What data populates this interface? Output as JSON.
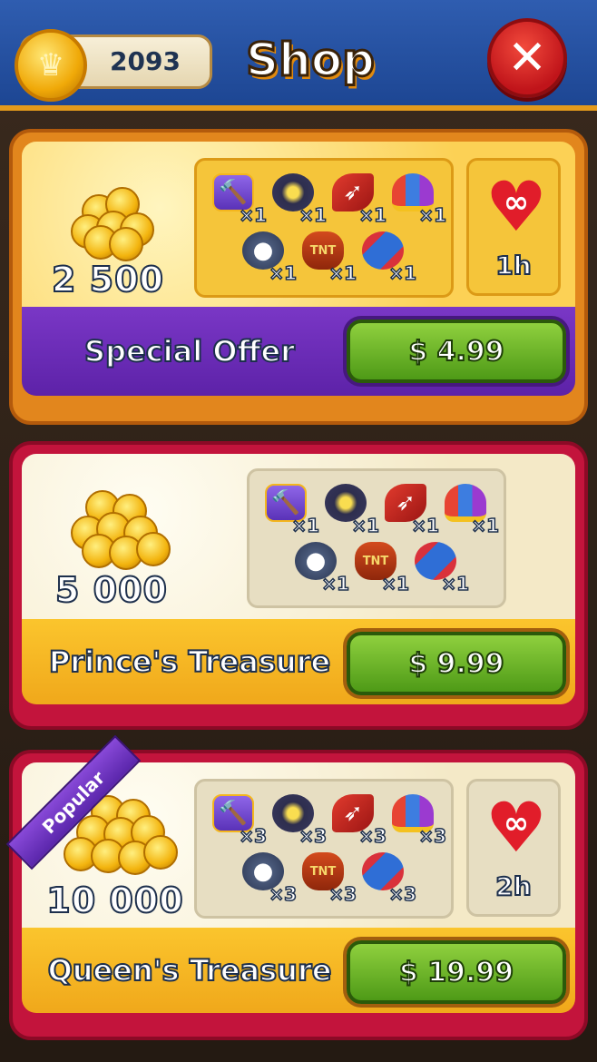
{
  "header": {
    "coin_count": "2093",
    "crown_glyph": "♛",
    "title": "Shop",
    "close_glyph": "✕"
  },
  "items_icons": [
    "hammer-booster",
    "cannon-booster",
    "arrow-booster",
    "jester-hat-booster",
    "color-bomb-booster",
    "tnt-booster",
    "rolling-pin-booster"
  ],
  "offers": [
    {
      "name": "Special Offer",
      "coins": "2 500",
      "price": "$ 4.99",
      "items": [
        "×1",
        "×1",
        "×1",
        "×1",
        "×1",
        "×1",
        "×1"
      ],
      "life": {
        "symbol": "∞",
        "duration": "1h"
      }
    },
    {
      "name": "Prince's Treasure",
      "coins": "5 000",
      "price": "$ 9.99",
      "items": [
        "×1",
        "×1",
        "×1",
        "×1",
        "×1",
        "×1",
        "×1"
      ]
    },
    {
      "name": "Queen's Treasure",
      "coins": "10 000",
      "price": "$ 19.99",
      "badge": "Popular",
      "items": [
        "×3",
        "×3",
        "×3",
        "×3",
        "×3",
        "×3",
        "×3"
      ],
      "life": {
        "symbol": "∞",
        "duration": "2h"
      }
    }
  ],
  "tnt_label": "TNT",
  "colors": {
    "header_blue": "#2f5db0",
    "special_frame": "#e2861d",
    "treasure_frame": "#c3143c",
    "purple_bar": "#7a37c6",
    "buy_green": "#6bb52a"
  }
}
